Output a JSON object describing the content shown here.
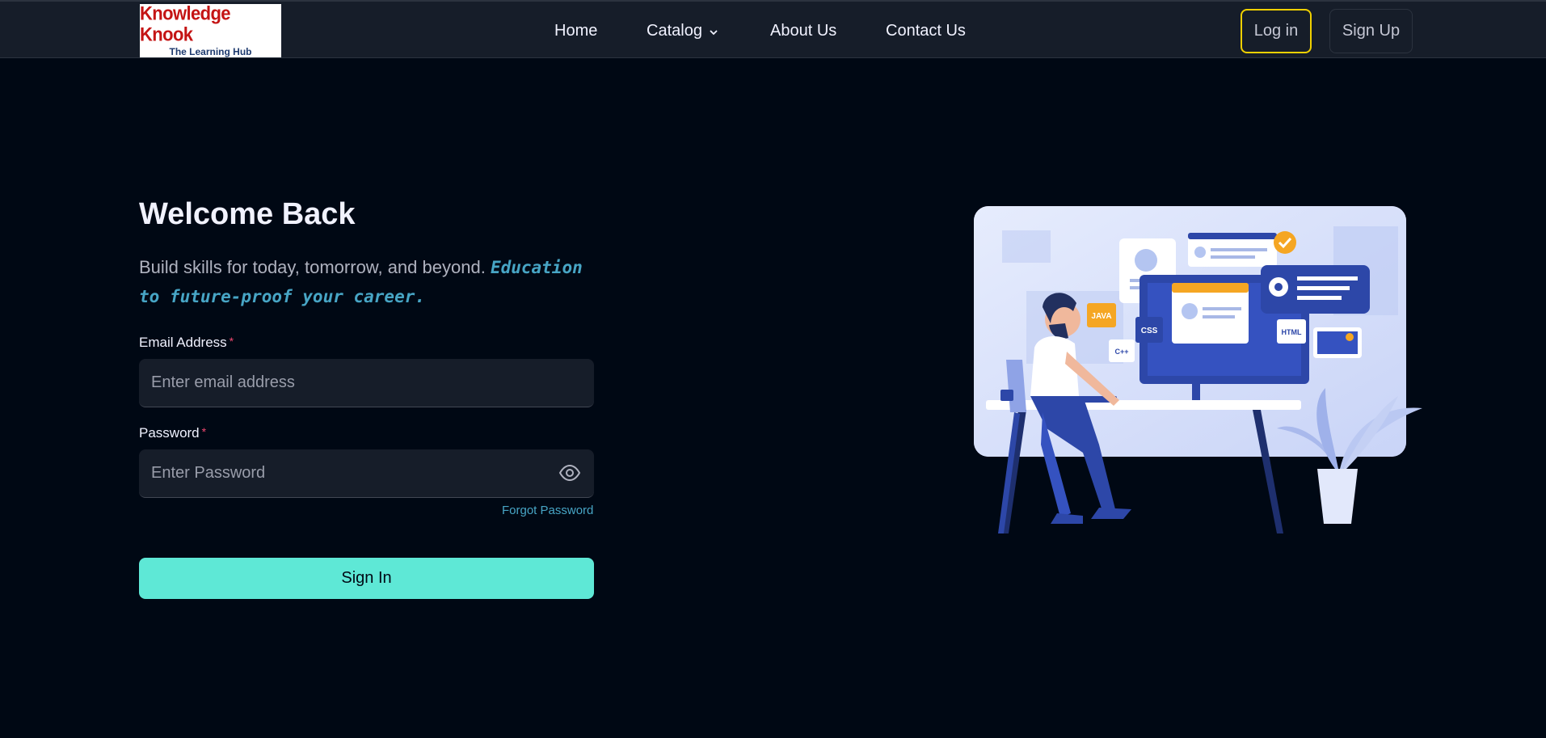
{
  "navbar": {
    "logo_title": "Knowledge Knook",
    "logo_subtitle": "The Learning Hub",
    "links": [
      {
        "label": "Home"
      },
      {
        "label": "Catalog"
      },
      {
        "label": "About Us"
      },
      {
        "label": "Contact Us"
      }
    ],
    "login_label": "Log in",
    "signup_label": "Sign Up"
  },
  "form": {
    "heading": "Welcome Back",
    "subtitle_plain": "Build skills for today, tomorrow, and beyond.",
    "subtitle_highlight": "Education to future-proof your career.",
    "email_label": "Email Address",
    "email_placeholder": "Enter email address",
    "required_mark": "*",
    "password_label": "Password",
    "password_placeholder": "Enter Password",
    "forgot_label": "Forgot Password",
    "signin_label": "Sign In"
  },
  "illustration": {
    "tags": [
      "JAVA",
      "CSS",
      "C++",
      "HTML"
    ]
  },
  "colors": {
    "background": "#000814",
    "navbar": "#161d29",
    "accent_yellow": "#f0d000",
    "accent_teal": "#5ee8d6",
    "highlight_blue": "#47a5c5",
    "logo_red": "#c41414"
  }
}
